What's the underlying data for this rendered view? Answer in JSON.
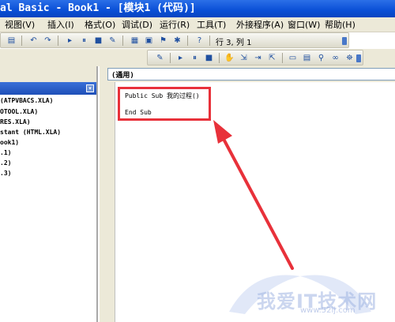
{
  "window": {
    "title": "al Basic - Book1 - [模块1 (代码)]"
  },
  "menubar": {
    "items": [
      "视图(V)",
      "插入(I)",
      "格式(O)",
      "调试(D)",
      "运行(R)",
      "工具(T)",
      "外接程序(A)",
      "窗口(W)",
      "帮助(H)"
    ]
  },
  "toolbar": {
    "row_col": "行 3, 列 1"
  },
  "project_tree": {
    "items": [
      "(ATPVBACS.XLA)",
      "OTOOL.XLA)",
      "RES.XLA)",
      "stant (HTML.XLA)",
      "ook1)",
      ".1)",
      ".2)",
      ".3)"
    ]
  },
  "code_window": {
    "object_combo": "(通用)",
    "lines": [
      "Public Sub 我的过程()",
      "End Sub"
    ]
  },
  "annotation": {
    "color": "#e8313a"
  },
  "watermark": {
    "text": "我爱IT技术网",
    "url": "www.52ij.com"
  }
}
